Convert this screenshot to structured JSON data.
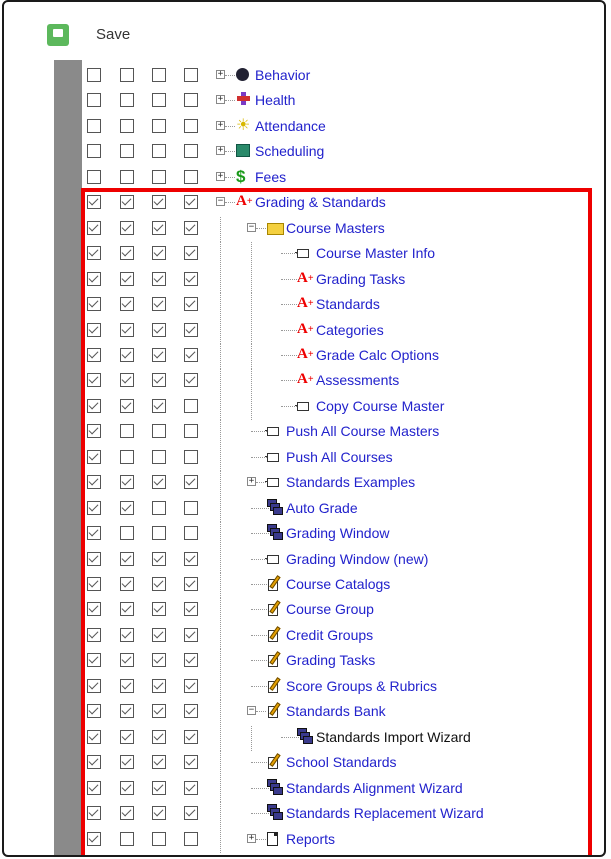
{
  "toolbar": {
    "save_label": "Save"
  },
  "colors": {
    "link": "#2222cc",
    "highlight": "#ee0000",
    "save_icon": "#5cb85c"
  },
  "tree": [
    {
      "label": "Behavior",
      "checks": [
        false,
        false,
        false,
        false
      ],
      "icon": "behavior-icon",
      "level": 0,
      "expander": "+"
    },
    {
      "label": "Health",
      "checks": [
        false,
        false,
        false,
        false
      ],
      "icon": "health-icon",
      "level": 0,
      "expander": "+"
    },
    {
      "label": "Attendance",
      "checks": [
        false,
        false,
        false,
        false
      ],
      "icon": "attendance-icon",
      "level": 0,
      "expander": "+"
    },
    {
      "label": "Scheduling",
      "checks": [
        false,
        false,
        false,
        false
      ],
      "icon": "scheduling-icon",
      "level": 0,
      "expander": "+"
    },
    {
      "label": "Fees",
      "checks": [
        false,
        false,
        false,
        false
      ],
      "icon": "fees-icon",
      "level": 0,
      "expander": "+"
    },
    {
      "label": "Grading & Standards",
      "checks": [
        true,
        true,
        true,
        true
      ],
      "icon": "grading-icon",
      "level": 0,
      "expander": "-"
    },
    {
      "label": "Course Masters",
      "checks": [
        true,
        true,
        true,
        true
      ],
      "icon": "folder-icon",
      "level": 1,
      "expander": "-"
    },
    {
      "label": "Course Master Info",
      "checks": [
        true,
        true,
        true,
        true
      ],
      "icon": "page-icon",
      "level": 2
    },
    {
      "label": "Grading Tasks",
      "checks": [
        true,
        true,
        true,
        true
      ],
      "icon": "grading-icon",
      "level": 2
    },
    {
      "label": "Standards",
      "checks": [
        true,
        true,
        true,
        true
      ],
      "icon": "grading-icon",
      "level": 2
    },
    {
      "label": "Categories",
      "checks": [
        true,
        true,
        true,
        true
      ],
      "icon": "grading-icon",
      "level": 2
    },
    {
      "label": "Grade Calc Options",
      "checks": [
        true,
        true,
        true,
        true
      ],
      "icon": "grading-icon",
      "level": 2
    },
    {
      "label": "Assessments",
      "checks": [
        true,
        true,
        true,
        true
      ],
      "icon": "grading-icon",
      "level": 2
    },
    {
      "label": "Copy Course Master",
      "checks": [
        true,
        true,
        true,
        false
      ],
      "icon": "page-icon",
      "level": 2
    },
    {
      "label": "Push All Course Masters",
      "checks": [
        true,
        false,
        false,
        false
      ],
      "icon": "page-icon",
      "level": 1
    },
    {
      "label": "Push All Courses",
      "checks": [
        true,
        false,
        false,
        false
      ],
      "icon": "page-icon",
      "level": 1
    },
    {
      "label": "Standards Examples",
      "checks": [
        true,
        true,
        true,
        true
      ],
      "icon": "page-icon",
      "level": 1,
      "expander": "+"
    },
    {
      "label": "Auto Grade",
      "checks": [
        true,
        true,
        false,
        false
      ],
      "icon": "windows-icon",
      "level": 1
    },
    {
      "label": "Grading Window",
      "checks": [
        true,
        false,
        false,
        false
      ],
      "icon": "windows-icon",
      "level": 1
    },
    {
      "label": "Grading Window (new)",
      "checks": [
        true,
        true,
        true,
        true
      ],
      "icon": "page-icon",
      "level": 1
    },
    {
      "label": "Course Catalogs",
      "checks": [
        true,
        true,
        true,
        true
      ],
      "icon": "edit-icon",
      "level": 1
    },
    {
      "label": "Course Group",
      "checks": [
        true,
        true,
        true,
        true
      ],
      "icon": "edit-icon",
      "level": 1
    },
    {
      "label": "Credit Groups",
      "checks": [
        true,
        true,
        true,
        true
      ],
      "icon": "edit-icon",
      "level": 1
    },
    {
      "label": "Grading Tasks",
      "checks": [
        true,
        true,
        true,
        true
      ],
      "icon": "edit-icon",
      "level": 1
    },
    {
      "label": "Score Groups & Rubrics",
      "checks": [
        true,
        true,
        true,
        true
      ],
      "icon": "edit-icon",
      "level": 1
    },
    {
      "label": "Standards Bank",
      "checks": [
        true,
        true,
        true,
        true
      ],
      "icon": "edit-icon",
      "level": 1,
      "expander": "-"
    },
    {
      "label": "Standards Import Wizard",
      "checks": [
        true,
        true,
        true,
        true
      ],
      "icon": "windows-icon",
      "level": 2,
      "black": true
    },
    {
      "label": "School Standards",
      "checks": [
        true,
        true,
        true,
        true
      ],
      "icon": "edit-icon",
      "level": 1
    },
    {
      "label": "Standards Alignment Wizard",
      "checks": [
        true,
        true,
        true,
        true
      ],
      "icon": "windows-icon",
      "level": 1
    },
    {
      "label": "Standards Replacement Wizard",
      "checks": [
        true,
        true,
        true,
        true
      ],
      "icon": "windows-icon",
      "level": 1
    },
    {
      "label": "Reports",
      "checks": [
        true,
        false,
        false,
        false
      ],
      "icon": "document-icon",
      "level": 1,
      "expander": "+"
    }
  ]
}
